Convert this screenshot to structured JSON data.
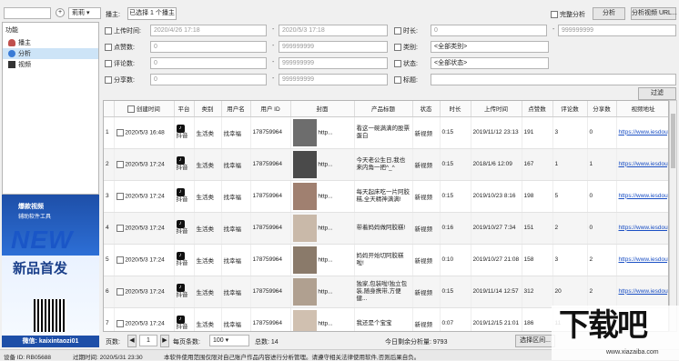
{
  "toolbar": {
    "account_value": "",
    "fav_label": "莉莉",
    "anchor_label": "播主:",
    "anchor_value": "已选择 1 个播主",
    "complete_label": "完整分析",
    "analyze_label": "分析",
    "analyze_url_label": "分析视频 URL..."
  },
  "sidebar": {
    "title": "功能",
    "items": [
      {
        "label": "播主",
        "icon": "user-icon"
      },
      {
        "label": "分析",
        "icon": "chart-icon"
      },
      {
        "label": "视频",
        "icon": "video-icon"
      }
    ]
  },
  "ad": {
    "line1": "爆款视频",
    "line2": "辅助软件工具",
    "big": "NEW",
    "mid": "新品首发",
    "wechat": "微信: kaixintaozi01"
  },
  "filters": {
    "upload_label": "上传时间:",
    "upload_from": "2020/4/26 17:18",
    "upload_to": "2020/5/3 17:18",
    "likes_label": "点赞数:",
    "likes_from": "0",
    "likes_to": "999999999",
    "comments_label": "评论数:",
    "comments_from": "0",
    "comments_to": "999999999",
    "shares_label": "分享数:",
    "shares_from": "0",
    "shares_to": "999999999",
    "duration_label": "时长:",
    "duration_from": "0",
    "duration_to": "999999999",
    "category_label": "类别:",
    "category_value": "<全部类别>",
    "status_label": "状态:",
    "status_value": "<全部状态>",
    "title_label": "标题:",
    "title_value": "",
    "filter_button": "过滤"
  },
  "table": {
    "columns": [
      "",
      "创建时间",
      "平台",
      "类别",
      "用户名",
      "用户 ID",
      "封面",
      "产品标题",
      "状态",
      "时长",
      "上传时间",
      "点赞数",
      "评论数",
      "分享数",
      "视频地址"
    ],
    "rows": [
      {
        "n": "1",
        "created": "2020/5/3 16:48",
        "platform": "抖音",
        "category": "生活类",
        "user": "找幸福",
        "uid": "178759964",
        "cover": "http...",
        "title": "看这一碗满满的股票蛋白",
        "status": "新视频",
        "dur": "0:15",
        "upload": "2019/11/12 23:13",
        "likes": "191",
        "comments": "3",
        "shares": "0",
        "url": "https://www.iesdouyi..."
      },
      {
        "n": "2",
        "created": "2020/5/3 17:24",
        "platform": "抖音",
        "category": "生活类",
        "user": "找幸福",
        "uid": "178759964",
        "cover": "http...",
        "title": "今天老公生日,我也来内角一把^_^",
        "status": "新视频",
        "dur": "0:15",
        "upload": "2018/1/6 12:09",
        "likes": "167",
        "comments": "1",
        "shares": "1",
        "url": "https://www.iesdouyi..."
      },
      {
        "n": "3",
        "created": "2020/5/3 17:24",
        "platform": "抖音",
        "category": "生活类",
        "user": "找幸福",
        "uid": "178759964",
        "cover": "http...",
        "title": "每天起床吃一片阿胶糕,全天精神满满!",
        "status": "新视频",
        "dur": "0:15",
        "upload": "2019/10/23 8:16",
        "likes": "198",
        "comments": "5",
        "shares": "0",
        "url": "https://www.iesdouyi..."
      },
      {
        "n": "4",
        "created": "2020/5/3 17:24",
        "platform": "抖音",
        "category": "生活类",
        "user": "找幸福",
        "uid": "178759964",
        "cover": "http...",
        "title": "带着妈妈做阿胶糕!",
        "status": "新视频",
        "dur": "0:16",
        "upload": "2019/10/27 7:34",
        "likes": "151",
        "comments": "2",
        "shares": "0",
        "url": "https://www.iesdouyi..."
      },
      {
        "n": "5",
        "created": "2020/5/3 17:24",
        "platform": "抖音",
        "category": "生活类",
        "user": "找幸福",
        "uid": "178759964",
        "cover": "http...",
        "title": "妈妈开始切阿胶糕啦!",
        "status": "新视频",
        "dur": "0:10",
        "upload": "2019/10/27 21:08",
        "likes": "158",
        "comments": "3",
        "shares": "2",
        "url": "https://www.iesdouyi..."
      },
      {
        "n": "6",
        "created": "2020/5/3 17:24",
        "platform": "抖音",
        "category": "生活类",
        "user": "找幸福",
        "uid": "178759964",
        "cover": "http...",
        "title": "独家,包装啦!独立包装,随身携带,方便健...",
        "status": "新视频",
        "dur": "0:15",
        "upload": "2019/11/14 12:57",
        "likes": "312",
        "comments": "20",
        "shares": "2",
        "url": "https://www.iesdouyi..."
      },
      {
        "n": "7",
        "created": "2020/5/3 17:24",
        "platform": "抖音",
        "category": "生活类",
        "user": "找幸福",
        "uid": "178759964",
        "cover": "http...",
        "title": "我还是个宝宝",
        "status": "新视频",
        "dur": "0:07",
        "upload": "2019/12/15 21:01",
        "likes": "186",
        "comments": "11",
        "shares": "",
        "url": ""
      }
    ]
  },
  "pager": {
    "page_label": "页数:",
    "page_value": "1",
    "per_page_label": "每页条数:",
    "per_page_value": "100",
    "total_label": "总数: 14",
    "remaining": "今日剩余分析量: 9793",
    "export_label": "选择区间..."
  },
  "status": {
    "device": "设备 ID: RB05688",
    "expire": "过期时间: 2020/5/31 23:30",
    "notice": "本软件使用范围仅限对自己账户作品内容进行分析管理。请遵守相关法律使用软件,否则后果自负。"
  },
  "watermark": {
    "big": "下载吧",
    "small": "www.xiazaiba.com"
  }
}
